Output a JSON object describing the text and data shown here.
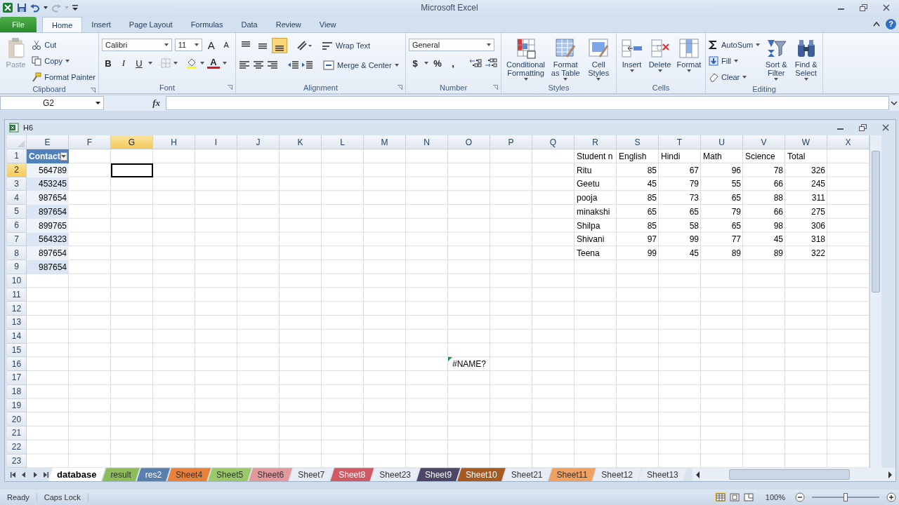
{
  "window": {
    "title": "Microsoft Excel",
    "help": "?"
  },
  "ribbon_tabs": [
    {
      "label": "File",
      "kind": "file",
      "selected": false
    },
    {
      "label": "Home",
      "kind": "tab",
      "selected": true
    },
    {
      "label": "Insert",
      "kind": "tab",
      "selected": false
    },
    {
      "label": "Page Layout",
      "kind": "tab",
      "selected": false
    },
    {
      "label": "Formulas",
      "kind": "tab",
      "selected": false
    },
    {
      "label": "Data",
      "kind": "tab",
      "selected": false
    },
    {
      "label": "Review",
      "kind": "tab",
      "selected": false
    },
    {
      "label": "View",
      "kind": "tab",
      "selected": false
    }
  ],
  "ribbon": {
    "clipboard": {
      "label": "Clipboard",
      "paste": "Paste",
      "cut": "Cut",
      "copy": "Copy",
      "format_painter": "Format Painter"
    },
    "font": {
      "label": "Font",
      "name": "Calibri",
      "size": "11",
      "grow": "A",
      "shrink": "A",
      "bold": "B",
      "italic": "I",
      "underline": "U",
      "color_glyph": "A"
    },
    "alignment": {
      "label": "Alignment",
      "vertical": [
        {
          "selected": false
        },
        {
          "selected": false
        },
        {
          "selected": true
        }
      ],
      "wrap_text": "Wrap Text",
      "merge_center": "Merge & Center"
    },
    "number": {
      "label": "Number",
      "format": "General",
      "currency": "$",
      "percent": "%",
      "comma": ","
    },
    "styles": {
      "label": "Styles",
      "buttons": [
        {
          "kind": "conditional",
          "lines": [
            "Conditional",
            "Formatting"
          ]
        },
        {
          "kind": "table",
          "lines": [
            "Format",
            "as Table"
          ]
        },
        {
          "kind": "cell-styles",
          "lines": [
            "Cell",
            "Styles"
          ]
        }
      ]
    },
    "cells": {
      "label": "Cells",
      "buttons": [
        {
          "kind": "insert",
          "lines": [
            "Insert"
          ]
        },
        {
          "kind": "delete",
          "lines": [
            "Delete"
          ]
        },
        {
          "kind": "format",
          "lines": [
            "Format"
          ]
        }
      ]
    },
    "editing": {
      "label": "Editing",
      "small": [
        {
          "kind": "sum",
          "label": "AutoSum"
        },
        {
          "kind": "fill",
          "label": "Fill"
        },
        {
          "kind": "clear",
          "label": "Clear"
        }
      ],
      "large": [
        {
          "kind": "sort",
          "lines": [
            "Sort &",
            "Filter"
          ]
        },
        {
          "kind": "find",
          "lines": [
            "Find &",
            "Select"
          ]
        }
      ]
    }
  },
  "formula_bar": {
    "name_box": "G2",
    "fx": "fx"
  },
  "workbook": {
    "title": "H6",
    "columns": [
      {
        "label": "E",
        "selected": false
      },
      {
        "label": "F",
        "selected": false
      },
      {
        "label": "G",
        "selected": true
      },
      {
        "label": "H",
        "selected": false
      },
      {
        "label": "I",
        "selected": false
      },
      {
        "label": "J",
        "selected": false
      },
      {
        "label": "K",
        "selected": false
      },
      {
        "label": "L",
        "selected": false
      },
      {
        "label": "M",
        "selected": false
      },
      {
        "label": "N",
        "selected": false
      },
      {
        "label": "O",
        "selected": false
      },
      {
        "label": "P",
        "selected": false
      },
      {
        "label": "Q",
        "selected": false
      },
      {
        "label": "R",
        "selected": false
      },
      {
        "label": "S",
        "selected": false
      },
      {
        "label": "T",
        "selected": false
      },
      {
        "label": "U",
        "selected": false
      },
      {
        "label": "V",
        "selected": false
      },
      {
        "label": "W",
        "selected": false
      },
      {
        "label": "X",
        "selected": false
      }
    ],
    "rows": [
      {
        "number": "1",
        "selected": false,
        "cells": [
          {
            "text": "Contact",
            "kind": "table-header"
          },
          null,
          null,
          null,
          null,
          null,
          null,
          null,
          null,
          null,
          null,
          null,
          null,
          {
            "text": "Student n",
            "kind": "text"
          },
          {
            "text": "English",
            "kind": "text"
          },
          {
            "text": "Hindi",
            "kind": "text"
          },
          {
            "text": "Math",
            "kind": "text"
          },
          {
            "text": "Science",
            "kind": "text"
          },
          {
            "text": "Total",
            "kind": "text"
          }
        ]
      },
      {
        "number": "2",
        "selected": true,
        "cells": [
          {
            "text": "564789",
            "kind": "table-number"
          },
          null,
          null,
          null,
          null,
          null,
          null,
          null,
          null,
          null,
          null,
          null,
          null,
          {
            "text": "Ritu",
            "kind": "text"
          },
          {
            "text": "85",
            "kind": "number"
          },
          {
            "text": "67",
            "kind": "number"
          },
          {
            "text": "96",
            "kind": "number"
          },
          {
            "text": "78",
            "kind": "number"
          },
          {
            "text": "326",
            "kind": "number"
          }
        ]
      },
      {
        "number": "3",
        "selected": false,
        "cells": [
          {
            "text": "453245",
            "kind": "table-number"
          },
          null,
          null,
          null,
          null,
          null,
          null,
          null,
          null,
          null,
          null,
          null,
          null,
          {
            "text": "Geetu",
            "kind": "text"
          },
          {
            "text": "45",
            "kind": "number"
          },
          {
            "text": "79",
            "kind": "number"
          },
          {
            "text": "55",
            "kind": "number"
          },
          {
            "text": "66",
            "kind": "number"
          },
          {
            "text": "245",
            "kind": "number"
          }
        ]
      },
      {
        "number": "4",
        "selected": false,
        "cells": [
          {
            "text": "987654",
            "kind": "table-number"
          },
          null,
          null,
          null,
          null,
          null,
          null,
          null,
          null,
          null,
          null,
          null,
          null,
          {
            "text": "pooja",
            "kind": "text"
          },
          {
            "text": "85",
            "kind": "number"
          },
          {
            "text": "73",
            "kind": "number"
          },
          {
            "text": "65",
            "kind": "number"
          },
          {
            "text": "88",
            "kind": "number"
          },
          {
            "text": "311",
            "kind": "number"
          }
        ]
      },
      {
        "number": "5",
        "selected": false,
        "cells": [
          {
            "text": "897654",
            "kind": "table-number"
          },
          null,
          null,
          null,
          null,
          null,
          null,
          null,
          null,
          null,
          null,
          null,
          null,
          {
            "text": "minakshi",
            "kind": "text"
          },
          {
            "text": "65",
            "kind": "number"
          },
          {
            "text": "65",
            "kind": "number"
          },
          {
            "text": "79",
            "kind": "number"
          },
          {
            "text": "66",
            "kind": "number"
          },
          {
            "text": "275",
            "kind": "number"
          }
        ]
      },
      {
        "number": "6",
        "selected": false,
        "cells": [
          {
            "text": "899765",
            "kind": "table-number"
          },
          null,
          null,
          null,
          null,
          null,
          null,
          null,
          null,
          null,
          null,
          null,
          null,
          {
            "text": "Shilpa",
            "kind": "text"
          },
          {
            "text": "85",
            "kind": "number"
          },
          {
            "text": "58",
            "kind": "number"
          },
          {
            "text": "65",
            "kind": "number"
          },
          {
            "text": "98",
            "kind": "number"
          },
          {
            "text": "306",
            "kind": "number"
          }
        ]
      },
      {
        "number": "7",
        "selected": false,
        "cells": [
          {
            "text": "564323",
            "kind": "table-number"
          },
          null,
          null,
          null,
          null,
          null,
          null,
          null,
          null,
          null,
          null,
          null,
          null,
          {
            "text": "Shivani",
            "kind": "text"
          },
          {
            "text": "97",
            "kind": "number"
          },
          {
            "text": "99",
            "kind": "number"
          },
          {
            "text": "77",
            "kind": "number"
          },
          {
            "text": "45",
            "kind": "number"
          },
          {
            "text": "318",
            "kind": "number"
          }
        ]
      },
      {
        "number": "8",
        "selected": false,
        "cells": [
          {
            "text": "897654",
            "kind": "table-number"
          },
          null,
          null,
          null,
          null,
          null,
          null,
          null,
          null,
          null,
          null,
          null,
          null,
          {
            "text": "Teena",
            "kind": "text"
          },
          {
            "text": "99",
            "kind": "number"
          },
          {
            "text": "45",
            "kind": "number"
          },
          {
            "text": "89",
            "kind": "number"
          },
          {
            "text": "89",
            "kind": "number"
          },
          {
            "text": "322",
            "kind": "number"
          }
        ]
      },
      {
        "number": "9",
        "selected": false,
        "cells": [
          {
            "text": "987654",
            "kind": "table-number"
          }
        ]
      },
      {
        "number": "10",
        "selected": false
      },
      {
        "number": "11",
        "selected": false
      },
      {
        "number": "12",
        "selected": false
      },
      {
        "number": "13",
        "selected": false
      },
      {
        "number": "14",
        "selected": false
      },
      {
        "number": "15",
        "selected": false
      },
      {
        "number": "16",
        "selected": false,
        "cells": [
          null,
          null,
          null,
          null,
          null,
          null,
          null,
          null,
          null,
          null,
          {
            "text": "#NAME?",
            "kind": "error"
          }
        ]
      },
      {
        "number": "17",
        "selected": false
      },
      {
        "number": "18",
        "selected": false
      },
      {
        "number": "19",
        "selected": false
      },
      {
        "number": "20",
        "selected": false
      },
      {
        "number": "21",
        "selected": false
      },
      {
        "number": "22",
        "selected": false
      },
      {
        "number": "23",
        "selected": false
      }
    ],
    "sheets": [
      {
        "label": "database",
        "selected": true
      },
      {
        "label": "result",
        "selected": false,
        "color": "#8fbc5a"
      },
      {
        "label": "res2",
        "selected": false,
        "color": "#5b7fad"
      },
      {
        "label": "Sheet4",
        "selected": false,
        "color": "#e8823a"
      },
      {
        "label": "Sheet5",
        "selected": false,
        "color": "#9bc96a"
      },
      {
        "label": "Sheet6",
        "selected": false,
        "color": "#e2999c"
      },
      {
        "label": "Sheet7",
        "selected": false
      },
      {
        "label": "Sheet8",
        "selected": false,
        "color": "#cf5a63"
      },
      {
        "label": "Sheet23",
        "selected": false
      },
      {
        "label": "Sheet9",
        "selected": false,
        "color": "#4e4666"
      },
      {
        "label": "Sheet10",
        "selected": false,
        "color": "#a65a22"
      },
      {
        "label": "Sheet21",
        "selected": false
      },
      {
        "label": "Sheet11",
        "selected": false,
        "color": "#f0a060"
      },
      {
        "label": "Sheet12",
        "selected": false
      },
      {
        "label": "Sheet13",
        "selected": false
      }
    ]
  },
  "status_bar": {
    "items": [
      "Ready",
      "Caps Lock"
    ],
    "zoom": "100%",
    "zoom_slider": {
      "level": 0.5
    }
  }
}
